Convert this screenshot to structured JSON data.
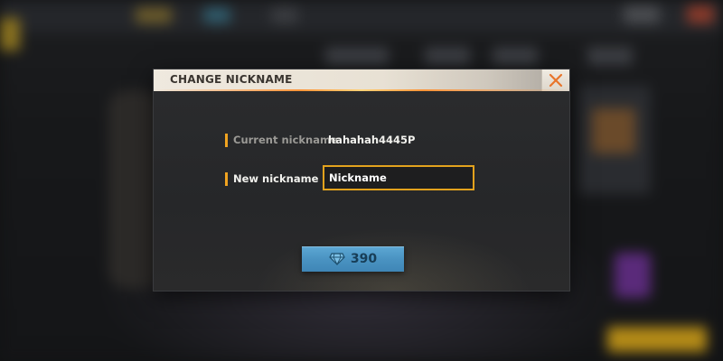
{
  "dialog": {
    "title": "CHANGE NICKNAME",
    "close_icon": "close-x-icon",
    "accent_color": "#f0a320"
  },
  "current_nickname": {
    "label": "Current nickname",
    "value": "hahahah4445P"
  },
  "new_nickname": {
    "label": "New nickname",
    "placeholder": "Nickname",
    "value": ""
  },
  "purchase_button": {
    "icon": "diamond-icon",
    "price": "390",
    "color": "#4a93c2"
  }
}
